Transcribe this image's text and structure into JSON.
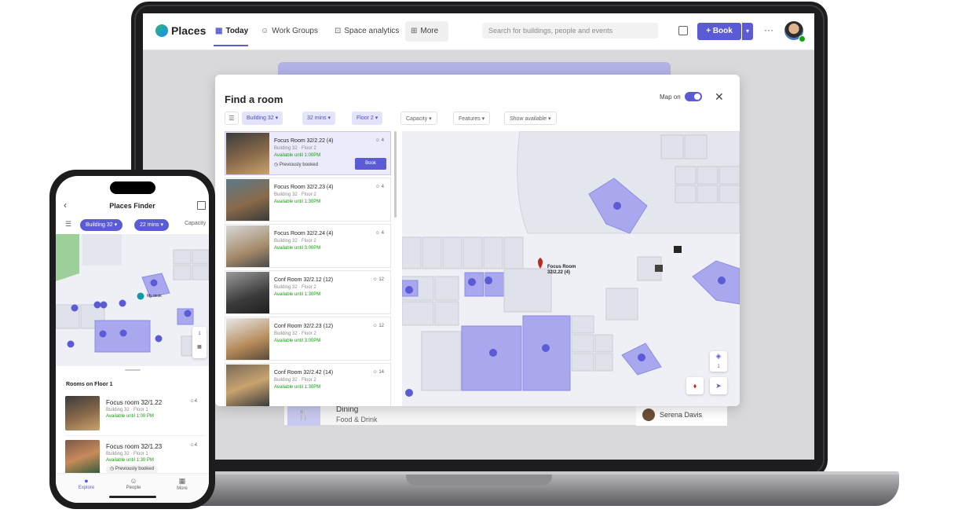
{
  "app": {
    "brand": "Places",
    "nav": [
      {
        "label": "Today",
        "icon": "calendar-icon"
      },
      {
        "label": "Work Groups",
        "icon": "people-icon"
      },
      {
        "label": "Space analytics",
        "icon": "analytics-icon"
      },
      {
        "label": "More",
        "icon": "grid-icon"
      }
    ],
    "search_placeholder": "Search for buildings, people and events",
    "book_label": "Book",
    "more_dots": "···"
  },
  "background": {
    "dining_title": "Dining",
    "dining_sub": "Food & Drink",
    "person": "Serena Davis"
  },
  "modal": {
    "title": "Find a room",
    "map_toggle_label": "Map on",
    "filters": [
      {
        "label": "Building 32",
        "active": true
      },
      {
        "label": "32 mins",
        "active": true
      },
      {
        "label": "Floor 2",
        "active": true
      },
      {
        "label": "Capacity",
        "active": false
      },
      {
        "label": "Features",
        "active": false
      },
      {
        "label": "Show available",
        "active": false
      }
    ],
    "rooms": [
      {
        "name": "Focus Room 32/2.22 (4)",
        "building": "Building 32 · Floor 2",
        "available": "Available until 1:00PM",
        "capacity": "4",
        "note": "Previously booked",
        "selected": true
      },
      {
        "name": "Focus Room 32/2.23 (4)",
        "building": "Building 32 · Floor 2",
        "available": "Available until 1:30PM",
        "capacity": "4"
      },
      {
        "name": "Focus Room 32/2.24 (4)",
        "building": "Building 32 · Floor 2",
        "available": "Available until 3:00PM",
        "capacity": "4"
      },
      {
        "name": "Conf Room 32/2.12 (12)",
        "building": "Building 32 · Floor 2",
        "available": "Available until 1:30PM",
        "capacity": "12"
      },
      {
        "name": "Conf Room 32/2.23 (12)",
        "building": "Building 32 · Floor 2",
        "available": "Available until 3:00PM",
        "capacity": "12"
      },
      {
        "name": "Conf Room 32/2.42 (14)",
        "building": "Building 32 · Floor 2",
        "available": "Available until 1:30PM",
        "capacity": "14"
      }
    ],
    "book_label": "Book",
    "map_pin_label": "Focus Room",
    "map_pin_sub": "32/2.22 (4)",
    "map_floor": "1"
  },
  "phone": {
    "title": "Places Finder",
    "chips": [
      "Building 32",
      "22 mins"
    ],
    "capacity": "Capacity",
    "map_label": "My desk",
    "floor_btn": "1",
    "section": "Rooms on Floor 1",
    "rooms": [
      {
        "name": "Focus room 32/1.22",
        "building": "Building 32 · Floor 1",
        "available": "Available until 1:00 PM",
        "capacity": "4"
      },
      {
        "name": "Focus room 32/1.23",
        "building": "Building 32 · Floor 1",
        "available": "Available until 1:30 PM",
        "capacity": "4",
        "note": "Previously booked"
      }
    ],
    "tabs": [
      {
        "label": "Explore",
        "icon": "explore-icon",
        "active": true
      },
      {
        "label": "People",
        "icon": "people-icon"
      },
      {
        "label": "More",
        "icon": "grid-icon"
      }
    ]
  },
  "colors": {
    "accent": "#5b5bd6",
    "available": "#13a10e",
    "room_fill": "#a9a8ef"
  }
}
